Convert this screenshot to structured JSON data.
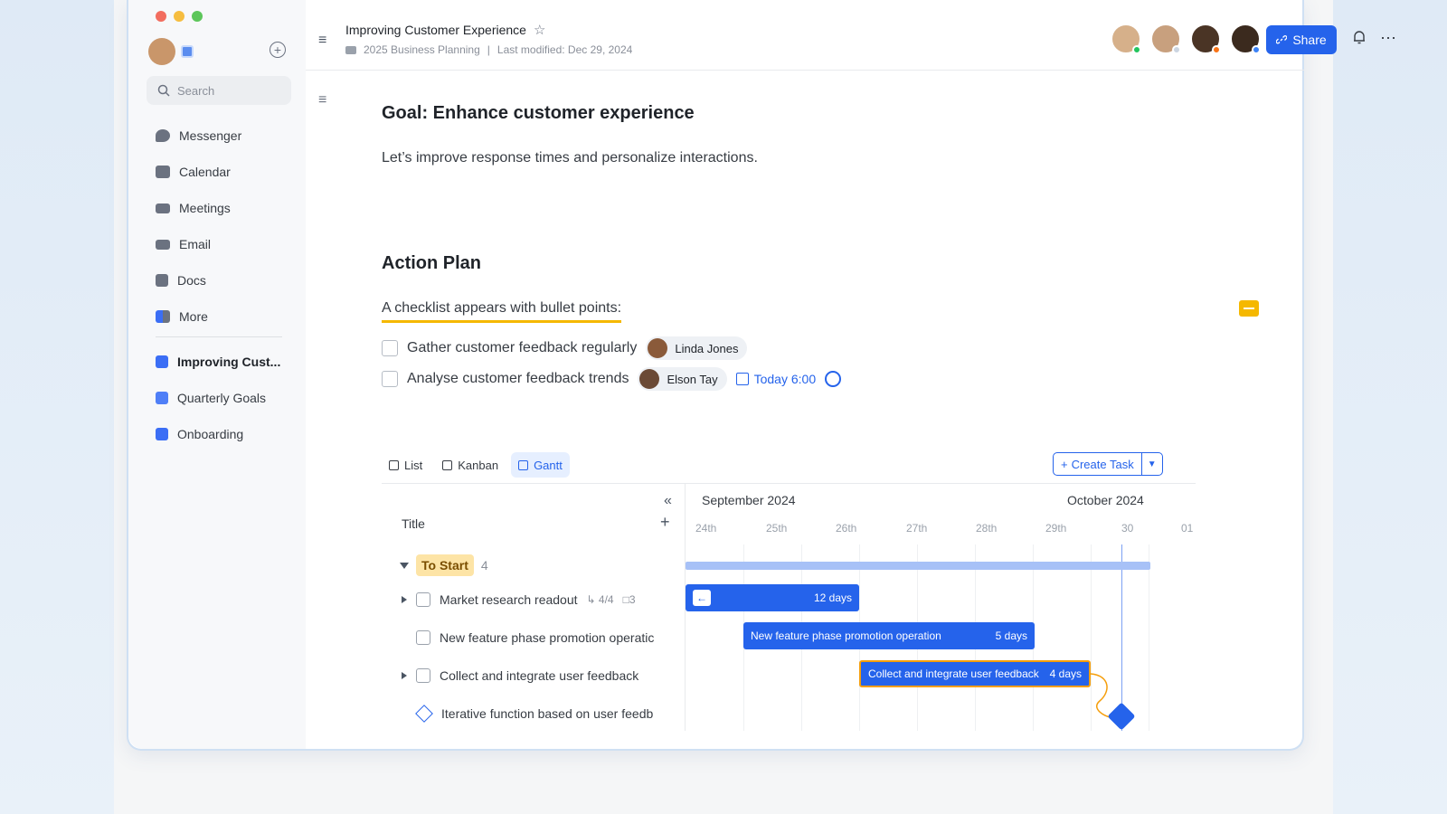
{
  "window": {
    "traffic_colors": [
      "#f26d5f",
      "#f6bd3f",
      "#5cc65a"
    ]
  },
  "sidebar": {
    "search_placeholder": "Search",
    "nav": [
      {
        "label": "Messenger",
        "icon": "messenger-icon"
      },
      {
        "label": "Calendar",
        "icon": "calendar-icon"
      },
      {
        "label": "Meetings",
        "icon": "meetings-icon"
      },
      {
        "label": "Email",
        "icon": "email-icon"
      },
      {
        "label": "Docs",
        "icon": "docs-icon"
      },
      {
        "label": "More",
        "icon": "more-icon"
      }
    ],
    "docs": [
      {
        "label": "Improving Cust...",
        "color": "#3b6ef5"
      },
      {
        "label": "Quarterly Goals",
        "color": "#4f7ff7"
      },
      {
        "label": "Onboarding",
        "color": "#3b6ef5"
      }
    ]
  },
  "header": {
    "title": "Improving Customer Experience",
    "folder": "2025 Business Planning",
    "separator": "|",
    "modified": "Last modified: Dec 29, 2024",
    "share_label": "Share",
    "more_glyph": "⋯",
    "collaborators": [
      {
        "color": "#d6b08a",
        "status": "#22c55e"
      },
      {
        "color": "#c8a07e",
        "status": "#cbd5e1"
      },
      {
        "color": "#4a3425",
        "status": "#f97316"
      },
      {
        "color": "#3b2a1e",
        "status": "#3b82f6"
      }
    ]
  },
  "doc": {
    "goal_title": "Goal: Enhance customer experience",
    "goal_text": "Let’s improve response times and personalize interactions.",
    "action_title": "Action Plan",
    "checklist_intro": "A checklist appears with bullet points:",
    "checklist": [
      {
        "text": "Gather customer feedback regularly",
        "person": "Linda Jones",
        "avatar": "#8a5a3a"
      },
      {
        "text": "Analyse customer feedback trends",
        "person": "Elson Tay",
        "avatar": "#6b4a36",
        "due": "Today 6:00"
      }
    ]
  },
  "views": {
    "tabs": [
      {
        "label": "List"
      },
      {
        "label": "Kanban"
      },
      {
        "label": "Gantt"
      }
    ],
    "active": "Gantt",
    "create_task": "Create Task"
  },
  "gantt": {
    "title_header": "Title",
    "months": [
      "September 2024",
      "October 2024"
    ],
    "days": [
      "24th",
      "25th",
      "26th",
      "27th",
      "28th",
      "29th",
      "30",
      "01"
    ],
    "group": {
      "label": "To Start",
      "count": "4"
    },
    "tasks": [
      {
        "title": "Market research readout",
        "subtasks": "4/4",
        "comments": "3",
        "bar_label": "",
        "duration": "12 days"
      },
      {
        "title": "New feature phase promotion operatic",
        "bar_label": "New feature phase promotion operation",
        "duration": "5 days"
      },
      {
        "title": "Collect and integrate user feedback",
        "bar_label": "Collect and integrate user feedback",
        "duration": "4 days"
      },
      {
        "title": "Iterative function based on user feedb"
      }
    ]
  }
}
